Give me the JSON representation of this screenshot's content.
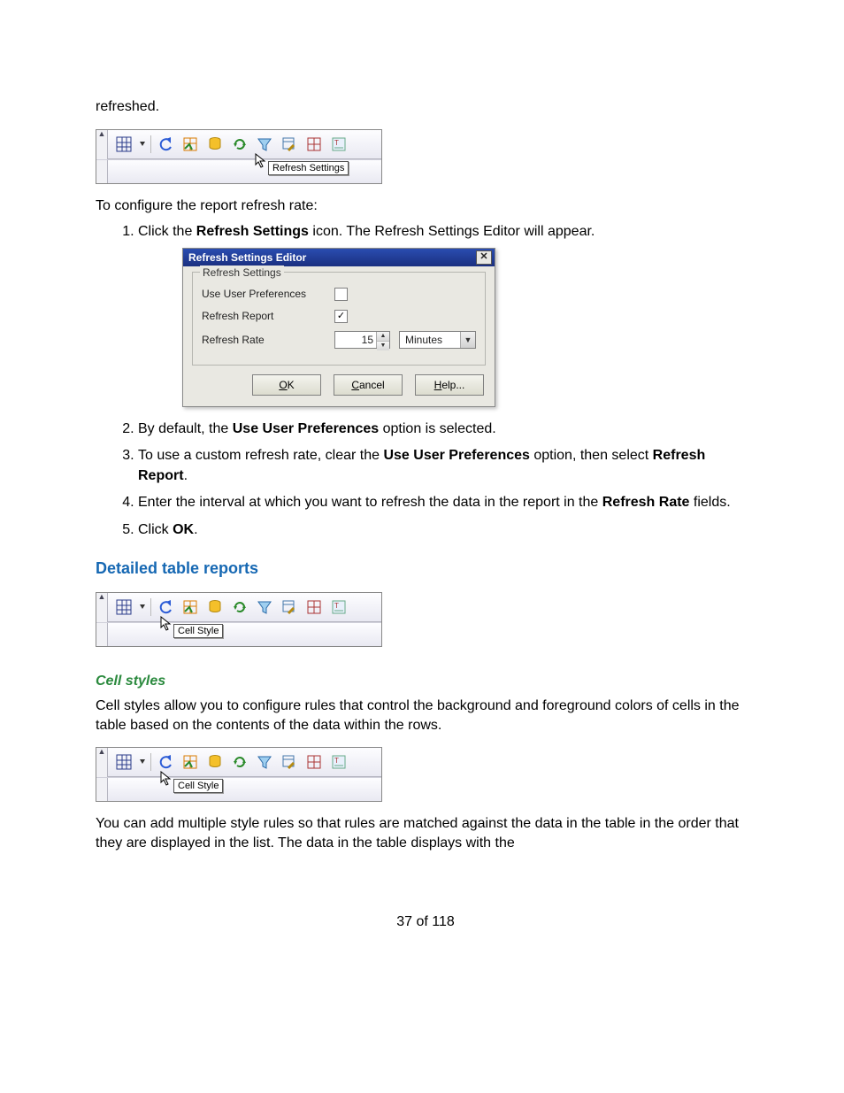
{
  "intro_tail": "refreshed.",
  "toolbar1_tooltip": "Refresh Settings",
  "para_configure": "To configure the report refresh rate:",
  "steps": {
    "s1_a": "Click the ",
    "s1_b": "Refresh Settings",
    "s1_c": " icon. The Refresh Settings Editor will appear.",
    "s2_a": "By default, the ",
    "s2_b": "Use User Preferences",
    "s2_c": " option is selected.",
    "s3_a": "To use a custom refresh rate, clear the ",
    "s3_b": "Use User Preferences",
    "s3_c": " option, then select ",
    "s3_d": "Refresh Report",
    "s3_e": ".",
    "s4_a": "Enter the interval at which you want to refresh the data in the report in the ",
    "s4_b": "Refresh Rate",
    "s4_c": " fields.",
    "s5_a": "Click ",
    "s5_b": "OK",
    "s5_c": "."
  },
  "dialog": {
    "title": "Refresh Settings Editor",
    "group": "Refresh Settings",
    "row1": "Use User Preferences",
    "row1_checked": false,
    "row2": "Refresh Report",
    "row2_checked": true,
    "row3": "Refresh Rate",
    "rate_value": "15",
    "rate_unit": "Minutes",
    "ok": "OK",
    "ok_ul": "O",
    "ok_rest": "K",
    "cancel_ul": "C",
    "cancel_rest": "ancel",
    "help_ul": "H",
    "help_rest": "elp..."
  },
  "section2": "Detailed table reports",
  "toolbar2_tooltip": "Cell Style",
  "sub_cellstyles": "Cell styles",
  "cellstyles_para": "Cell styles allow you to configure rules that control the background and foreground colors of cells in the table based on the contents of the data within the rows.",
  "toolbar3_tooltip": "Cell Style",
  "final_para": "You can add multiple style rules so that rules are matched against the data in the table in the order that they are displayed in the list. The data in the table displays with the",
  "page_footer": "37 of 118"
}
